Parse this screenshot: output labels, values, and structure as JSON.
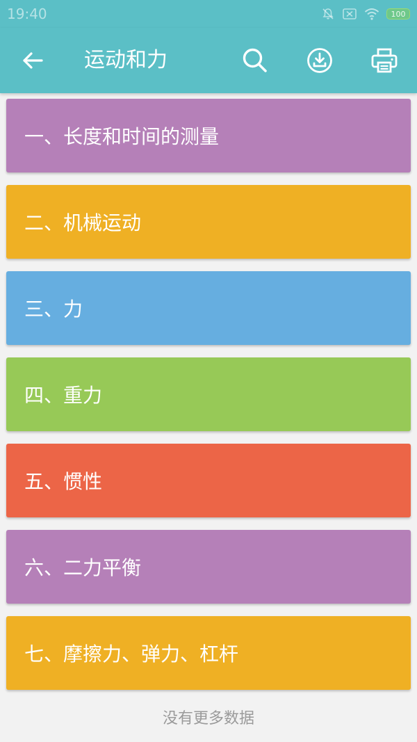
{
  "status_bar": {
    "time": "19:40",
    "battery": "100"
  },
  "app_bar": {
    "title": "运动和力",
    "icons": [
      "back-arrow-icon",
      "search-icon",
      "download-icon",
      "print-icon"
    ]
  },
  "list": {
    "items": [
      {
        "label": "一、长度和时间的测量",
        "color": "#b580b8"
      },
      {
        "label": "二、机械运动",
        "color": "#efb024"
      },
      {
        "label": "三、力",
        "color": "#66aee0"
      },
      {
        "label": "四、重力",
        "color": "#97c957"
      },
      {
        "label": "五、惯性",
        "color": "#ec6547"
      },
      {
        "label": "六、二力平衡",
        "color": "#b580b8"
      },
      {
        "label": "七、摩擦力、弹力、杠杆",
        "color": "#efb024"
      }
    ]
  },
  "footer": {
    "text": "没有更多数据"
  },
  "colors": {
    "primary": "#5bbfc6",
    "background": "#f2f2f2"
  }
}
